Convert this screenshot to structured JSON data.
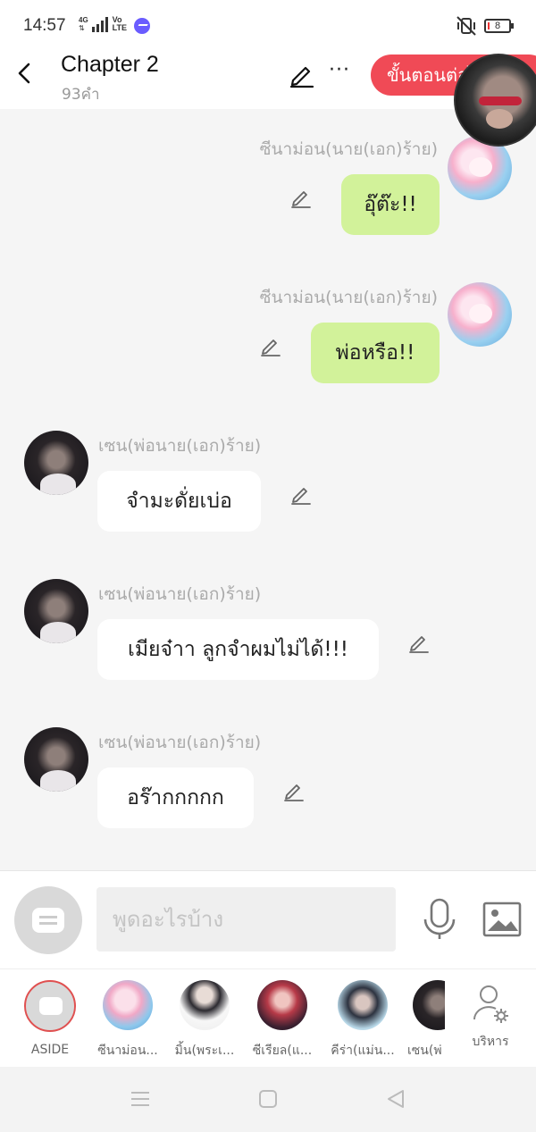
{
  "status_bar": {
    "time": "14:57",
    "network_tag": "4G",
    "volte": "Vo LTE",
    "battery": "8"
  },
  "header": {
    "title": "Chapter 2",
    "word_count": "93คำ",
    "step_button": "ขั้นตอนต่อไป"
  },
  "messages": [
    {
      "side": "right",
      "sender": "ซีนาม่อน(นาย(เอก)ร้าย)",
      "text": "อุ๊ต๊ะ!!",
      "avatar": "pink-hair-avatar"
    },
    {
      "side": "right",
      "sender": "ซีนาม่อน(นาย(เอก)ร้าย)",
      "text": "พ่อหรือ!!",
      "avatar": "pink-hair-avatar"
    },
    {
      "side": "left",
      "sender": "เซน(พ่อนาย(เอก)ร้าย)",
      "text": "จำมะดั่ยเบ่อ",
      "avatar": "dark-hair-avatar"
    },
    {
      "side": "left",
      "sender": "เซน(พ่อนาย(เอก)ร้าย)",
      "text": "เมียจ๋าา ลูกจำผมไม่ได้!!!",
      "avatar": "dark-hair-avatar"
    },
    {
      "side": "left",
      "sender": "เซน(พ่อนาย(เอก)ร้าย)",
      "text": "อร๊ากกกกก",
      "avatar": "dark-hair-avatar"
    }
  ],
  "input_bar": {
    "placeholder": "พูดอะไรบ้าง"
  },
  "characters": [
    {
      "label": "ASIDE"
    },
    {
      "label": "ซีนาม่อน..."
    },
    {
      "label": "มิ้น(พระเ..."
    },
    {
      "label": "ซีเรียล(แ..."
    },
    {
      "label": "คีร่า(แม่น..."
    },
    {
      "label": "เซน(พ่"
    },
    {
      "label": "บริหาร"
    }
  ],
  "colors": {
    "accent_red": "#f04a56",
    "my_bubble": "#d2f29a",
    "their_bubble": "#ffffff",
    "background": "#f5f5f5"
  }
}
